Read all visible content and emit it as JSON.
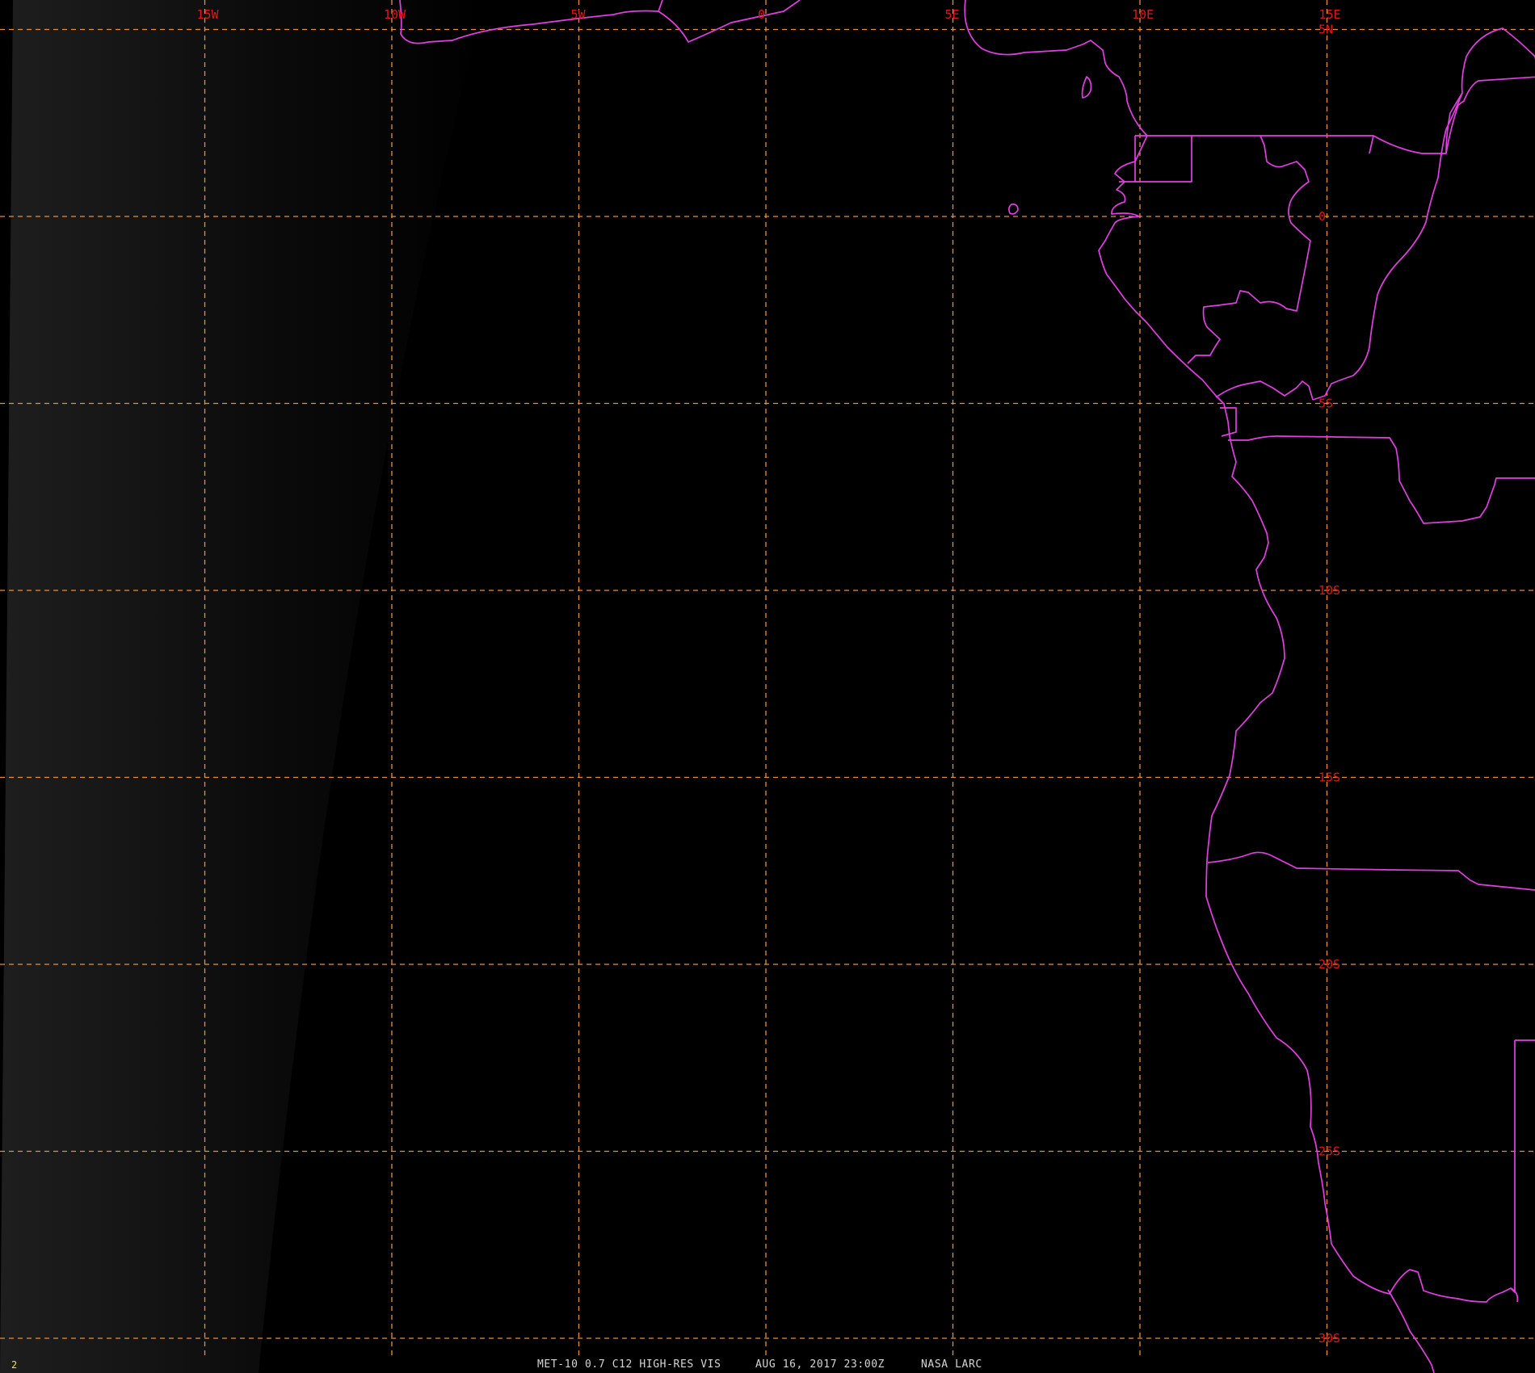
{
  "map": {
    "lon_labels": [
      {
        "lon": -15,
        "text": "15W"
      },
      {
        "lon": -10,
        "text": "10W"
      },
      {
        "lon": -5,
        "text": "5W"
      },
      {
        "lon": 0,
        "text": "0"
      },
      {
        "lon": 5,
        "text": "5E"
      },
      {
        "lon": 10,
        "text": "10E"
      },
      {
        "lon": 15,
        "text": "15E"
      }
    ],
    "lat_labels": [
      {
        "lat": 5,
        "text": "5N"
      },
      {
        "lat": 0,
        "text": "0"
      },
      {
        "lat": -5,
        "text": "5S"
      },
      {
        "lat": -10,
        "text": "10S"
      },
      {
        "lat": -15,
        "text": "15S"
      },
      {
        "lat": -20,
        "text": "20S"
      },
      {
        "lat": -25,
        "text": "25S"
      },
      {
        "lat": -30,
        "text": "30S"
      }
    ],
    "colors": {
      "background": "#000000",
      "grid": "#e8903a",
      "coastline": "#e23fe2",
      "tick_labels": "#e01818",
      "status_text": "#d6d6d6",
      "frame_number": "#e6e63a"
    }
  },
  "status_bar": {
    "frame_number": "2",
    "product": "MET-10 0.7 C12 HIGH-RES VIS",
    "datetime": "AUG 16, 2017 23:00Z",
    "source": "NASA LARC"
  }
}
